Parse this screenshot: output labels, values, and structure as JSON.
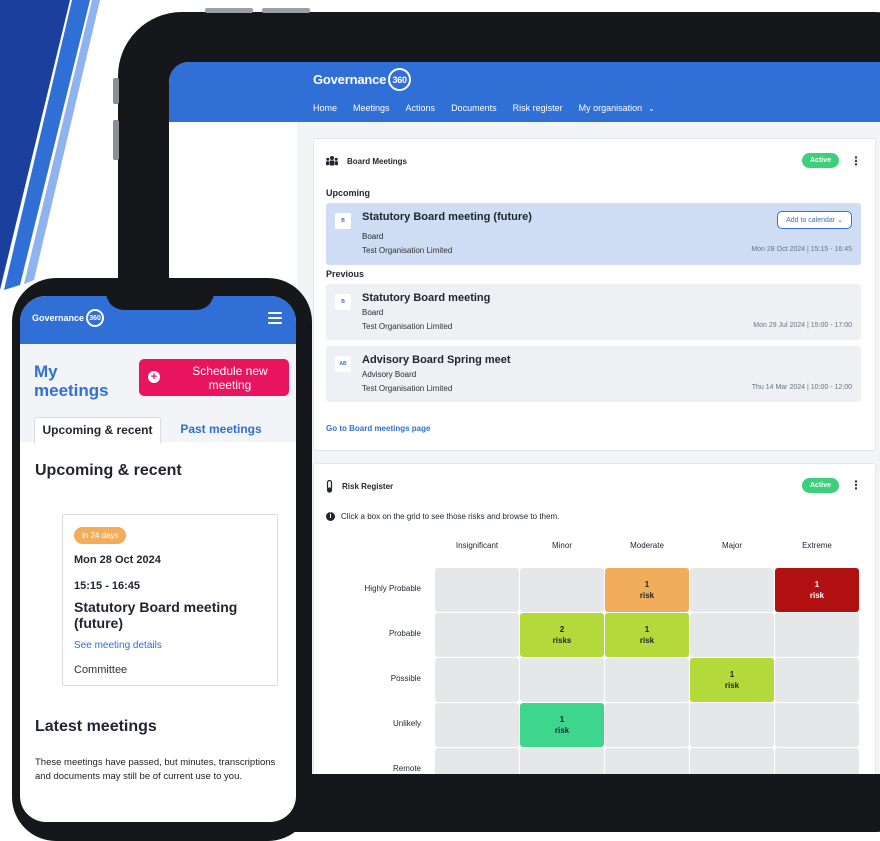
{
  "colors": {
    "brand_blue": "#2f6fd6",
    "accent_pink": "#e8155e",
    "active_green": "#3ecf7a",
    "risk_orange": "#f2ad5b",
    "risk_red": "#b01010",
    "risk_lime": "#b3d93a",
    "risk_green": "#3dd68c",
    "countdown_orange": "#f2ad5b"
  },
  "tablet": {
    "brand": {
      "name": "Governance",
      "badge": "360"
    },
    "nav": {
      "home": "Home",
      "meetings": "Meetings",
      "actions": "Actions",
      "documents": "Documents",
      "risk_register": "Risk register",
      "my_org": "My organisation"
    },
    "board": {
      "title": "Board Meetings",
      "status": "Active",
      "upcoming_label": "Upcoming",
      "previous_label": "Previous",
      "calendar_button": "Add to calendar",
      "meetings": [
        {
          "tag": "B",
          "title": "Statutory Board meeting (future)",
          "type": "Board",
          "org": "Test Organisation Limited",
          "date": "Mon 28 Oct 2024 | 15:15 - 16:45"
        },
        {
          "tag": "B",
          "title": "Statutory Board meeting",
          "type": "Board",
          "org": "Test Organisation Limited",
          "date": "Mon 29 Jul 2024 | 15:00 - 17:00"
        },
        {
          "tag": "AB",
          "title": "Advisory Board Spring meet",
          "type": "Advisory Board",
          "org": "Test Organisation Limited",
          "date": "Thu 14 Mar 2024 | 10:00 - 12:00"
        }
      ],
      "page_link": "Go to Board meetings page"
    },
    "risk": {
      "title": "Risk Register",
      "status": "Active",
      "info": "Click a box on the grid to see those risks and browse to them.",
      "columns": [
        "Insignificant",
        "Minor",
        "Moderate",
        "Major",
        "Extreme"
      ],
      "rows": [
        "Highly Probable",
        "Probable",
        "Possible",
        "Unlikely",
        "Remote"
      ],
      "cells": [
        {
          "row": 0,
          "col": 2,
          "count": "1",
          "unit": "risk",
          "color": "#f2ad5b"
        },
        {
          "row": 0,
          "col": 4,
          "count": "1",
          "unit": "risk",
          "color": "#b01010"
        },
        {
          "row": 1,
          "col": 1,
          "count": "2",
          "unit": "risks",
          "color": "#b3d93a"
        },
        {
          "row": 1,
          "col": 2,
          "count": "1",
          "unit": "risk",
          "color": "#b3d93a"
        },
        {
          "row": 2,
          "col": 3,
          "count": "1",
          "unit": "risk",
          "color": "#b3d93a"
        },
        {
          "row": 3,
          "col": 1,
          "count": "1",
          "unit": "risk",
          "color": "#3dd68c"
        }
      ]
    }
  },
  "phone": {
    "brand": {
      "name": "Governance",
      "badge": "360"
    },
    "title": "My meetings",
    "schedule_button": "Schedule new meeting",
    "tabs": {
      "upcoming": "Upcoming & recent",
      "past": "Past meetings"
    },
    "section_upcoming": "Upcoming & recent",
    "card": {
      "countdown": "in 24 days",
      "date": "Mon 28 Oct 2024",
      "time": "15:15 - 16:45",
      "title": "Statutory Board meeting (future)",
      "link": "See meeting details",
      "type": "Committee"
    },
    "section_latest": "Latest meetings",
    "latest_text": "These meetings have passed, but minutes, transcriptions and documents may still be of current use to you."
  }
}
